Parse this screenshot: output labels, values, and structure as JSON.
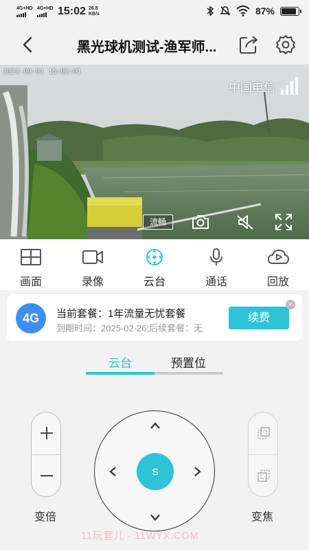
{
  "status_bar": {
    "sim1": "4G+HD",
    "sim2": "4G+HD",
    "time": "15:02",
    "speed_value": "26.8",
    "speed_unit": "KB/s",
    "battery": "87%",
    "battery_level": 0.87,
    "icons": [
      "bluetooth-icon",
      "mute-icon",
      "wifi-icon",
      "battery-icon"
    ]
  },
  "header": {
    "title": "黑光球机测试-渔军师...",
    "icons": [
      "back-icon",
      "share-icon",
      "gear-icon"
    ]
  },
  "video": {
    "timestamp": "2024-09-01 15:02:01",
    "carrier": "中国电信",
    "quality": "流畅",
    "controls": [
      "camera-icon",
      "mute-icon",
      "fullscreen-icon"
    ]
  },
  "tools": [
    {
      "label": "画面",
      "icon": "grid-icon"
    },
    {
      "label": "录像",
      "icon": "video-record-icon"
    },
    {
      "label": "云台",
      "icon": "ptz-icon",
      "active": true
    },
    {
      "label": "通话",
      "icon": "microphone-icon"
    },
    {
      "label": "回放",
      "icon": "cloud-playback-icon"
    }
  ],
  "package": {
    "badge": "4G",
    "current_label": "当前套餐：1年流量无忧套餐",
    "expiry": "到期时间：2025-02-26;后续套餐：无",
    "renew_label": "续费",
    "close": "×"
  },
  "ptz": {
    "tabs": [
      {
        "label": "云台",
        "active": true
      },
      {
        "label": "预置位",
        "active": false
      }
    ],
    "zoom_label": "变倍",
    "zoom_plus": "+",
    "zoom_minus": "—",
    "focus_label": "变焦",
    "center_label": "S"
  },
  "watermark": "11玩套儿 · 11WYX.COM",
  "colors": {
    "accent": "#2ec3d6",
    "badge_blue": "#3c8ff0",
    "background": "#f2f2f2"
  }
}
